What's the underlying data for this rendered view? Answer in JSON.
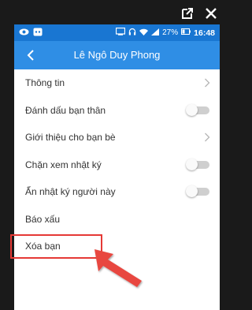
{
  "status_bar": {
    "battery_percent": "27%",
    "time": "16:48",
    "icons": [
      "eye-icon",
      "app-notification-icon",
      "screen-icon",
      "headset-icon",
      "wifi-icon",
      "signal-icon",
      "battery-icon"
    ]
  },
  "frame": {
    "icons": [
      "external-link-icon",
      "close-icon"
    ]
  },
  "header": {
    "title": "Lê Ngô Duy Phong",
    "back_icon": "back-icon"
  },
  "menu": {
    "items": [
      {
        "label": "Thông tin",
        "control": "chevron"
      },
      {
        "label": "Đánh dấu bạn thân",
        "control": "toggle",
        "on": false
      },
      {
        "label": "Giới thiệu cho bạn bè",
        "control": "chevron"
      },
      {
        "label": "Chặn xem nhật ký",
        "control": "toggle",
        "on": false
      },
      {
        "label": "Ẩn nhật ký người này",
        "control": "toggle",
        "on": false
      },
      {
        "label": "Báo xấu",
        "control": "none"
      },
      {
        "label": "Xóa bạn",
        "control": "none"
      }
    ]
  },
  "colors": {
    "status_bar": "#1976d2",
    "app_bar": "#2f8ee5",
    "highlight": "#e53935",
    "arrow": "#e8473f"
  }
}
